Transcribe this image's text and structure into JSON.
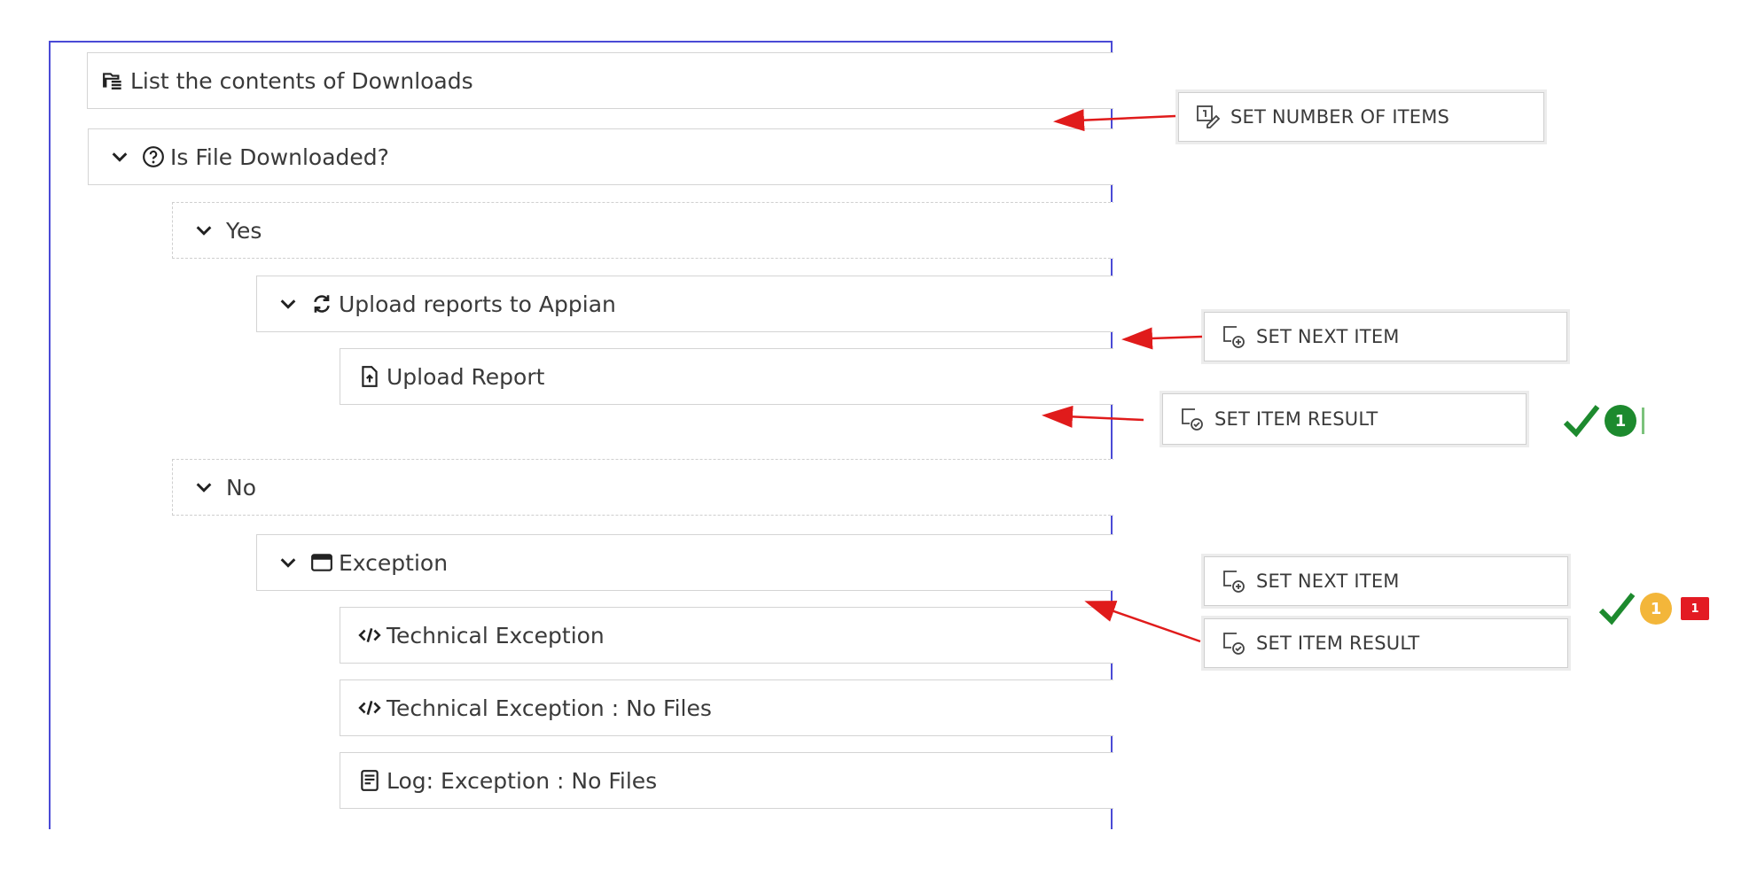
{
  "tree": {
    "list_downloads": "List the contents of Downloads",
    "is_file_downloaded": "Is File Downloaded?",
    "yes_branch": "Yes",
    "upload_reports": "Upload reports to Appian",
    "upload_report": "Upload Report",
    "no_branch": "No",
    "exception": "Exception",
    "technical_exception": "Technical Exception",
    "technical_exception_no_files": "Technical Exception : No Files",
    "log_exception_no_files": "Log: Exception : No Files"
  },
  "actions": {
    "set_number_of_items": "SET NUMBER OF ITEMS",
    "set_next_item_1": "SET NEXT ITEM",
    "set_item_result_1": "SET ITEM RESULT",
    "set_next_item_2": "SET NEXT ITEM",
    "set_item_result_2": "SET ITEM RESULT"
  },
  "status": {
    "success_count_1": "1",
    "warning_count": "1",
    "error_count": "1"
  },
  "colors": {
    "frame": "#4a4ad6",
    "arrow": "#e01b1b",
    "success": "#1d8a2e",
    "warning": "#f3b63a",
    "error": "#e31b23"
  }
}
